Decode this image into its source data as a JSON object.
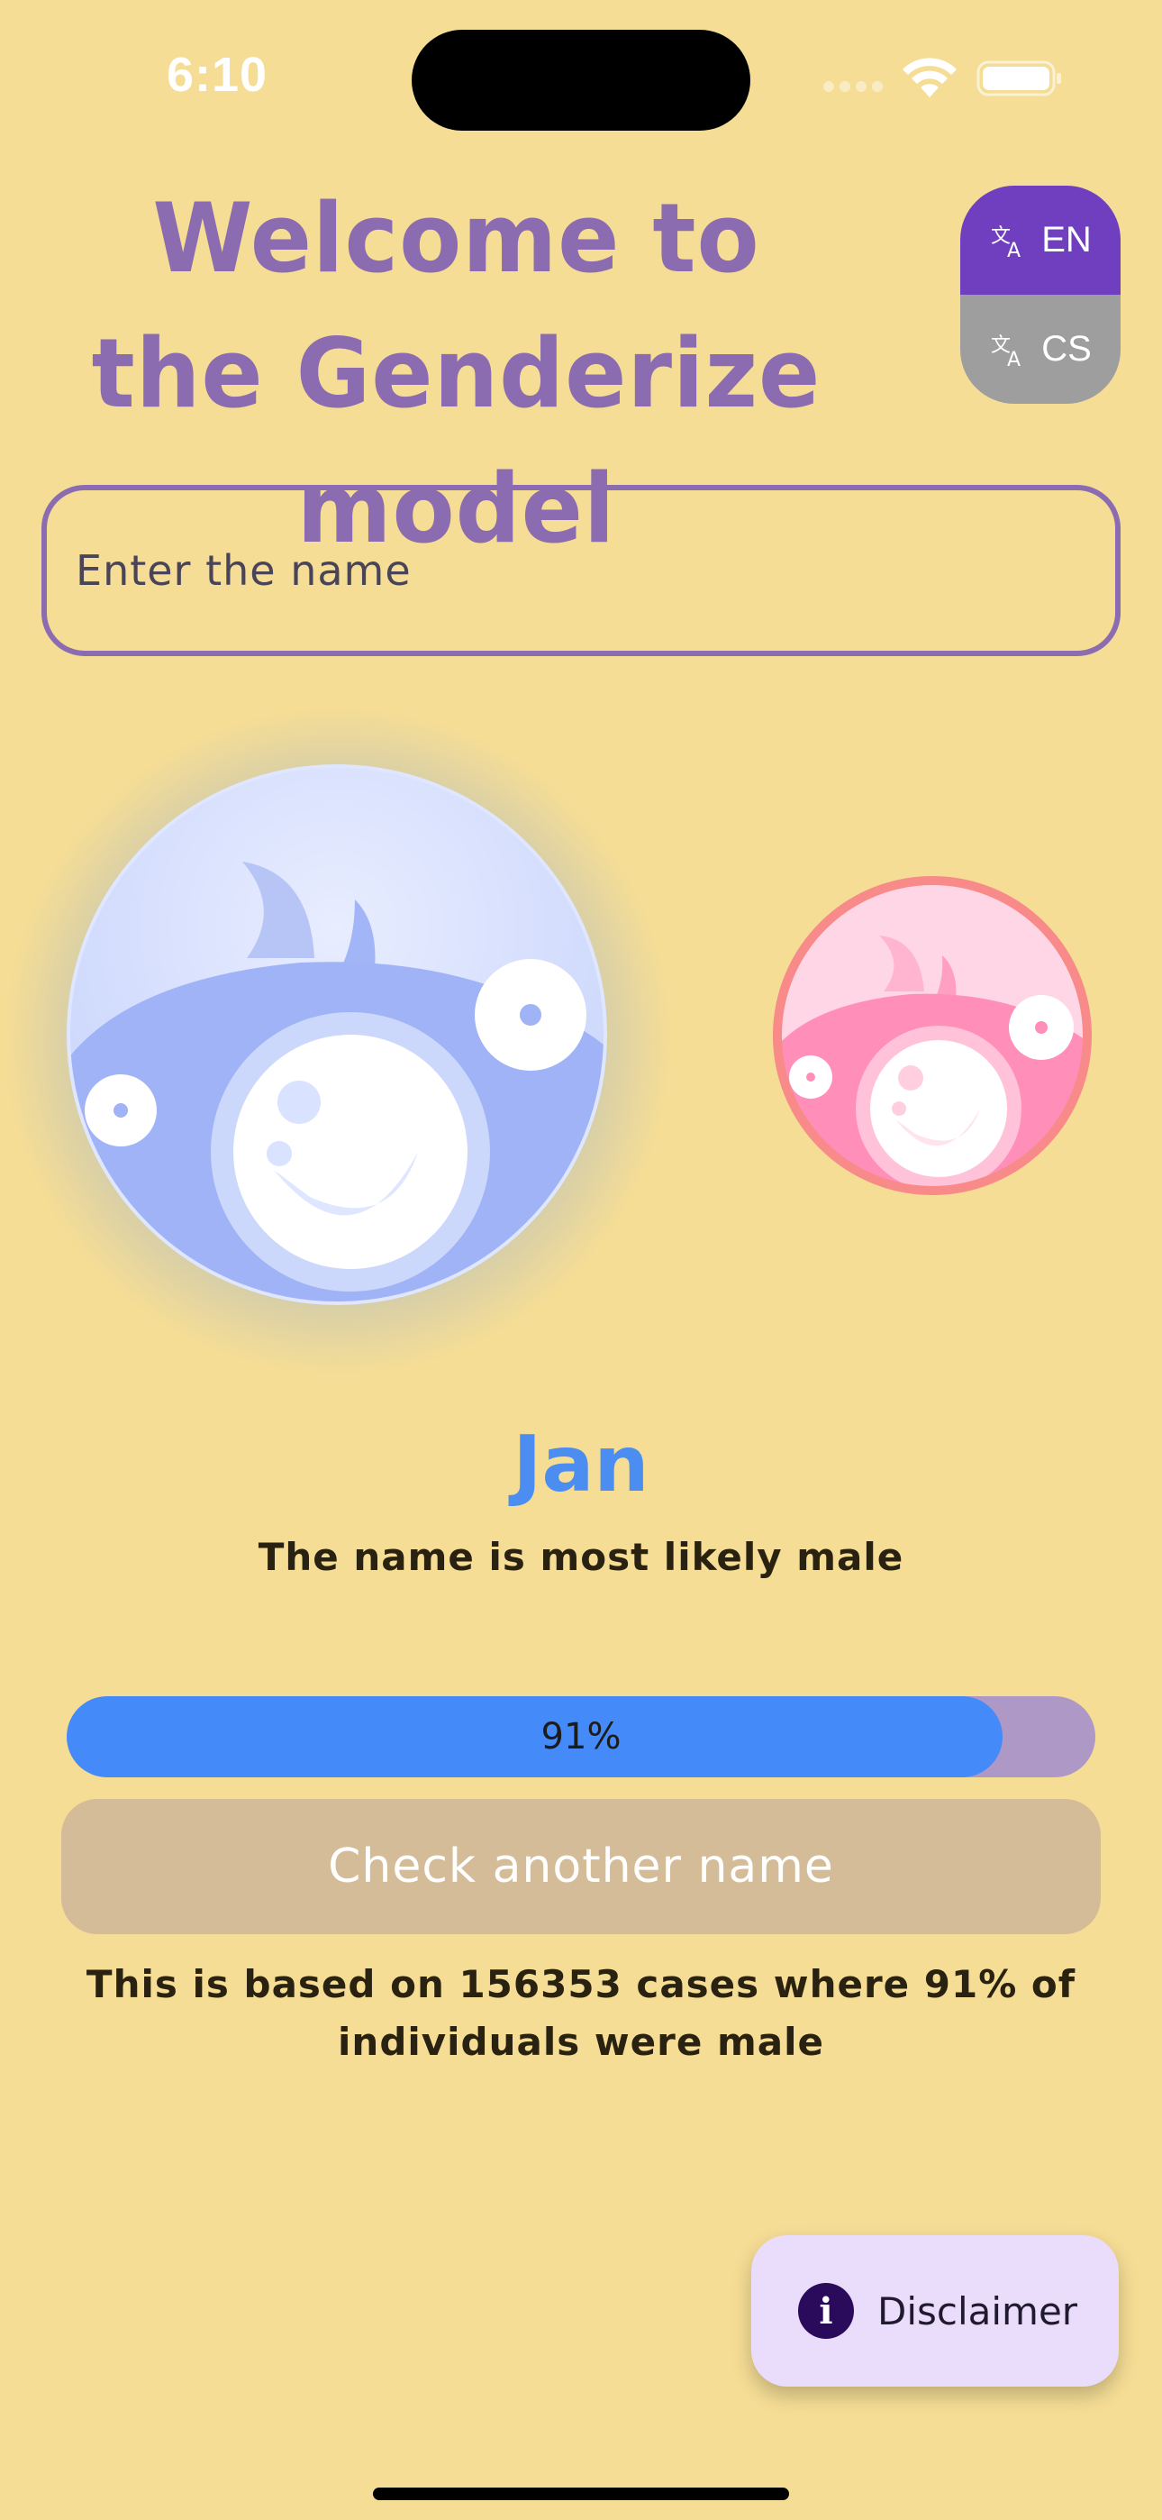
{
  "status_bar": {
    "time": "6:10"
  },
  "header": {
    "title": "Welcome to the Genderize model",
    "languages": [
      {
        "code": "EN",
        "active": true
      },
      {
        "code": "CS",
        "active": false
      }
    ]
  },
  "search": {
    "placeholder": "Enter the name",
    "value": ""
  },
  "result": {
    "name": "Jan",
    "summary": "The name is most likely male",
    "probability_percent": 91,
    "probability_label": "91%",
    "basis_text": "This is based on 156353 cases where 91% of individuals were male"
  },
  "actions": {
    "check_another_label": "Check another name",
    "disclaimer_label": "Disclaimer"
  },
  "colors": {
    "background": "#f5dd95",
    "accent_purple": "#8b6cb0",
    "male_blue": "#448bf9",
    "female_pink": "#ff8fb8"
  },
  "icons": {
    "language": "translate-icon",
    "disclaimer": "info-icon"
  }
}
